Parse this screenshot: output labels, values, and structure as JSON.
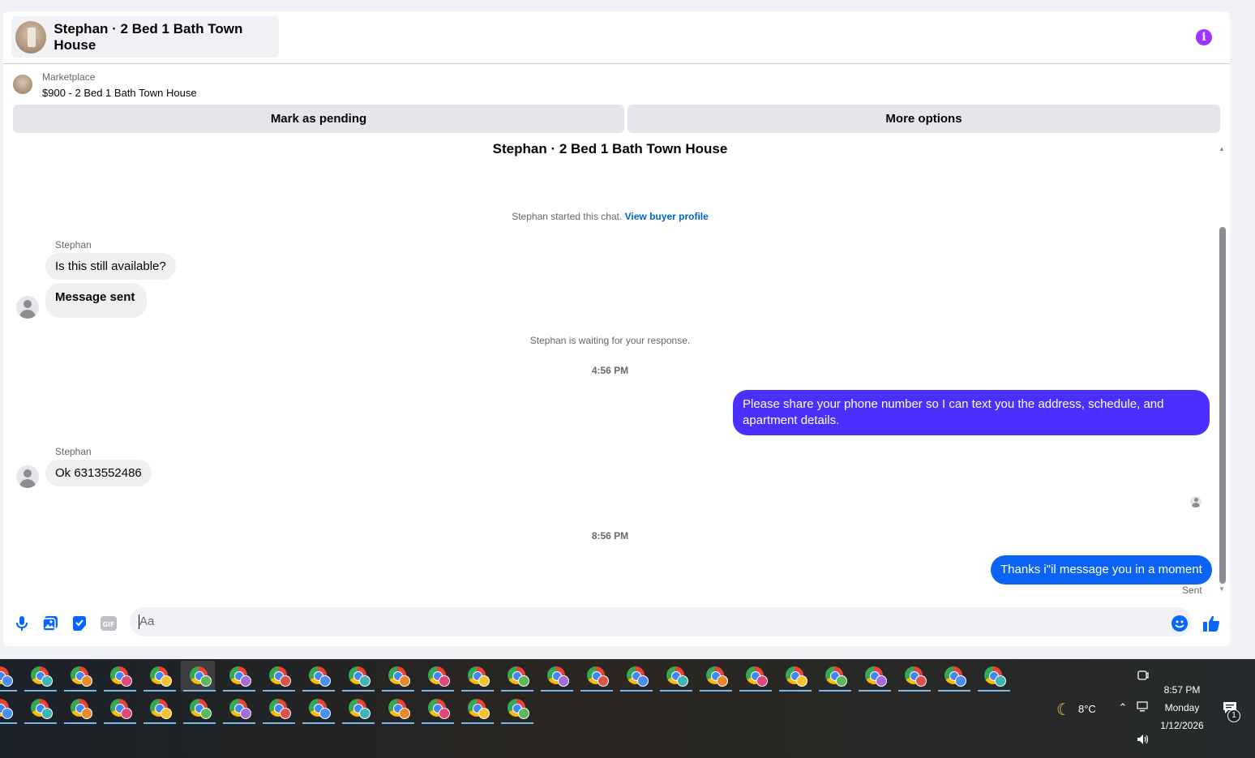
{
  "header": {
    "title": "Stephan · 2 Bed 1 Bath Town House"
  },
  "listing": {
    "label": "Marketplace",
    "item": "$900 - 2 Bed 1 Bath Town House",
    "mark_pending": "Mark as pending",
    "more_options": "More options"
  },
  "chat": {
    "title": "Stephan · 2 Bed 1 Bath Town House",
    "started_text": "Stephan started this chat.",
    "view_profile": "View buyer profile",
    "sender1": "Stephan",
    "msg1": "Is this still available?",
    "msg2": "Message sent",
    "waiting": "Stephan is waiting for your response.",
    "time1": "4:56 PM",
    "out1": "Please share your phone number so I can text you the address, schedule, and apartment details.",
    "sender2": "Stephan",
    "msg3": "Ok 6313552486",
    "time2": "8:56 PM",
    "out2": "Thanks i\"il message you in a moment",
    "sent": "Sent"
  },
  "composer": {
    "placeholder": "Aa"
  },
  "taskbar": {
    "weather": "8°C",
    "time": "8:57 PM",
    "day": "Monday",
    "date": "1/12/2026",
    "notifications": "1"
  },
  "colors": {
    "accent": "#0866ff",
    "outgoing_purple": "#4b2fff",
    "outgoing_blue": "#0a63f5",
    "info": "#a033ff"
  },
  "icons": [
    "info-icon",
    "microphone-icon",
    "photo-icon",
    "sticker-icon",
    "gif-icon",
    "emoji-icon",
    "thumbs-up-icon",
    "chrome-icon",
    "moon-icon",
    "chevron-up-icon",
    "network-icon",
    "volume-icon",
    "notification-icon",
    "meet-now-icon"
  ]
}
